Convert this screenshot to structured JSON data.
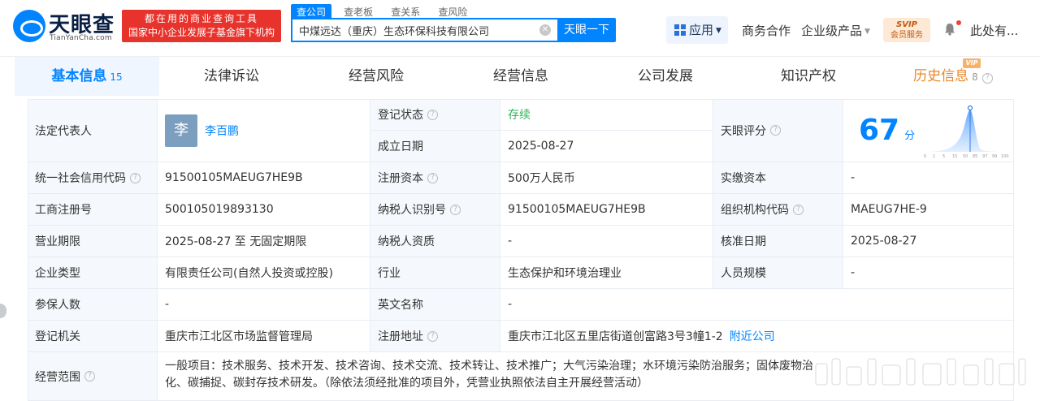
{
  "header": {
    "logo_name": "天眼查",
    "logo_domain": "TianYanCha.com",
    "promo_line1": "都在用的商业查询工具",
    "promo_line2": "国家中小企业发展子基金旗下机构",
    "search_tabs": [
      "查公司",
      "查老板",
      "查关系",
      "查风险"
    ],
    "search_value": "中煤远达（重庆）生态环保科技有限公司",
    "search_button": "天眼一下",
    "app_label": "应用",
    "nav": [
      "商务合作",
      "企业级产品"
    ],
    "svip_line1": "SVIP",
    "svip_line2": "会员服务",
    "user_name": "此处有..."
  },
  "tabs": [
    {
      "label": "基本信息",
      "count": "15"
    },
    {
      "label": "法律诉讼"
    },
    {
      "label": "经营风险"
    },
    {
      "label": "经营信息"
    },
    {
      "label": "公司发展"
    },
    {
      "label": "知识产权"
    },
    {
      "label": "历史信息",
      "count": "8",
      "badge": "VIP"
    }
  ],
  "info": {
    "legal_rep_label": "法定代表人",
    "legal_rep_avatar": "李",
    "legal_rep_name": "李百鹏",
    "reg_status_label": "登记状态",
    "reg_status_value": "存续",
    "found_date_label": "成立日期",
    "found_date_value": "2025-08-27",
    "score_label": "天眼评分",
    "score_value": "67",
    "score_unit": "分",
    "score_axis": [
      "0",
      "1",
      "5",
      "15",
      "50",
      "85",
      "97",
      "99",
      "100"
    ],
    "credit_code_label": "统一社会信用代码",
    "credit_code_value": "91500105MAEUG7HE9B",
    "reg_capital_label": "注册资本",
    "reg_capital_value": "500万人民币",
    "paid_capital_label": "实缴资本",
    "paid_capital_value": "-",
    "biz_reg_no_label": "工商注册号",
    "biz_reg_no_value": "500105019893130",
    "taxpayer_id_label": "纳税人识别号",
    "taxpayer_id_value": "91500105MAEUG7HE9B",
    "org_code_label": "组织机构代码",
    "org_code_value": "MAEUG7HE-9",
    "term_label": "营业期限",
    "term_value": "2025-08-27 至 无固定期限",
    "taxpayer_qual_label": "纳税人资质",
    "taxpayer_qual_value": "-",
    "approve_date_label": "核准日期",
    "approve_date_value": "2025-08-27",
    "company_type_label": "企业类型",
    "company_type_value": "有限责任公司(自然人投资或控股)",
    "industry_label": "行业",
    "industry_value": "生态保护和环境治理业",
    "staff_size_label": "人员规模",
    "staff_size_value": "-",
    "insured_label": "参保人数",
    "insured_value": "-",
    "english_name_label": "英文名称",
    "english_name_value": "-",
    "reg_authority_label": "登记机关",
    "reg_authority_value": "重庆市江北区市场监督管理局",
    "reg_address_label": "注册地址",
    "reg_address_value": "重庆市江北区五里店街道创富路3号3幢1-2",
    "nearby_link": "附近公司",
    "scope_label": "经营范围",
    "scope_line1": "一般项目：技术服务、技术开发、技术咨询、技术交流、技术转让、技术推广；大气污染治理；水环境污染防治服务；固体废物治",
    "scope_line2": "化、碳捕捉、碳封存技术研发。（除依法须经批准的项目外，凭营业执照依法自主开展经营活动）"
  },
  "colors": {
    "brand_blue": "#0084ff",
    "promo_red": "#e8322c",
    "status_green": "#30b35a",
    "history_orange": "#e8892b"
  }
}
